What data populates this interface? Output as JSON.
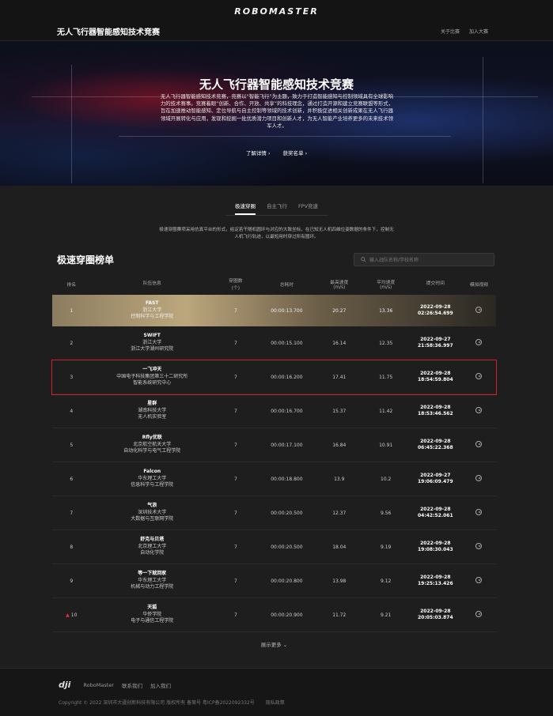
{
  "brand": {
    "logo": "ROBOMASTER"
  },
  "nav": {
    "title": "无人飞行器智能感知技术竞赛",
    "links": [
      "关于比赛",
      "加入大赛"
    ]
  },
  "hero": {
    "title": "无人飞行器智能感知技术竞赛",
    "description": "无人飞行器智能感知技术竞赛，竞赛以“智能飞行”为主题，致力于打造智能感知与控制领域具有全球影响力的技术赛事。竞赛着眼“创新、合作、开放、共享”的科技理念，通过打造开源和建立竞赛联盟等形式，旨在加速推动智能感知、定位导航与自主控制等领域的技术创新，并积极促进相关创新成果在无人飞行器领域开展转化与应用，发现和挖掘一批优质潜力项目和创新人才，为无人智能产业培养更多的未来技术领军人才。",
    "links": [
      "了解详情 ›",
      "获奖名单 ›"
    ]
  },
  "tabs": [
    "极速穿圈",
    "自主飞行",
    "FPV竞速"
  ],
  "active_tab": 0,
  "intro": "极速穿圈赛项采用仿真平台的形式，给定若干随机圆环与对应的大致坐标，在已知无人机四维位姿数据的条件下，控制无人机飞行轨迹，以最短用时穿过所有圆环。",
  "board": {
    "title": "极速穿圈榜单",
    "search_placeholder": "输入战队名称/学校名称",
    "columns": [
      "排名",
      "队伍信息",
      "穿圈数\n(个)",
      "总耗时",
      "最高速度\n(m/s)",
      "平均速度\n(m/s)",
      "提交时间",
      "模拟视频"
    ],
    "rows": [
      {
        "rank": "1",
        "team": "FAST",
        "school": "浙江大学",
        "dept": "控制科学与工程学院",
        "count": "7",
        "time": "00:00:13.700",
        "max": "20.27",
        "avg": "13.36",
        "date": "2022-09-28",
        "clock": "02:26:54.699"
      },
      {
        "rank": "2",
        "team": "SWIFT",
        "school": "浙江大学",
        "dept": "浙江大学湖州研究院",
        "count": "7",
        "time": "00:00:15.100",
        "max": "16.14",
        "avg": "12.35",
        "date": "2022-09-27",
        "clock": "21:58:36.997"
      },
      {
        "rank": "3",
        "team": "一飞冲天",
        "school": "中国电子科技集团第三十二研究所",
        "dept": "智能系统研究中心",
        "count": "7",
        "time": "00:00:16.200",
        "max": "17.41",
        "avg": "11.75",
        "date": "2022-09-28",
        "clock": "18:54:59.804"
      },
      {
        "rank": "4",
        "team": "星群",
        "school": "湖南科技大学",
        "dept": "无人机实验室",
        "count": "7",
        "time": "00:00:16.700",
        "max": "15.37",
        "avg": "11.42",
        "date": "2022-09-28",
        "clock": "18:53:46.562"
      },
      {
        "rank": "5",
        "team": "Rfly优联",
        "school": "北京航空航天大学",
        "dept": "自动化科学与电气工程学院",
        "count": "7",
        "time": "00:00:17.100",
        "max": "16.84",
        "avg": "10.91",
        "date": "2022-09-28",
        "clock": "06:45:22.368"
      },
      {
        "rank": "6",
        "team": "Falcon",
        "school": "华东理工大学",
        "dept": "信息科学与工程学院",
        "count": "7",
        "time": "00:00:18.800",
        "max": "13.9",
        "avg": "10.2",
        "date": "2022-09-27",
        "clock": "19:06:09.479"
      },
      {
        "rank": "7",
        "team": "气浪",
        "school": "深圳技术大学",
        "dept": "大数据与互联网学院",
        "count": "7",
        "time": "00:00:20.500",
        "max": "12.37",
        "avg": "9.56",
        "date": "2022-09-28",
        "clock": "04:42:52.061"
      },
      {
        "rank": "8",
        "team": "舒克与贝塔",
        "school": "北京理工大学",
        "dept": "自动化学院",
        "count": "7",
        "time": "00:00:20.500",
        "max": "18.04",
        "avg": "9.19",
        "date": "2022-09-28",
        "clock": "19:08:30.043"
      },
      {
        "rank": "9",
        "team": "等一下就回家",
        "school": "华东理工大学",
        "dept": "机械与动力工程学院",
        "count": "7",
        "time": "00:00:20.800",
        "max": "13.98",
        "avg": "9.12",
        "date": "2022-09-28",
        "clock": "19:25:13.426"
      },
      {
        "rank": "10",
        "team": "天狐",
        "school": "华侨学院",
        "dept": "电子与通信工程学院",
        "count": "7",
        "time": "00:00:20.900",
        "max": "11.72",
        "avg": "9.21",
        "date": "2022-09-28",
        "clock": "20:05:03.874"
      }
    ],
    "more": "展示更多 ⌄"
  },
  "footer": {
    "logo": "dji",
    "links": [
      "RoboMaster",
      "联系我们",
      "加入我们"
    ],
    "copyright": "Copyright © 2022 深圳市大疆创新科技有限公司 版权所有 备案号 粤ICP备2022092332号",
    "privacy": "隐私政策"
  },
  "colors": {
    "highlight_border": "#d0202a",
    "gold_row": "#bca77d",
    "background": "#1e1e1e"
  }
}
